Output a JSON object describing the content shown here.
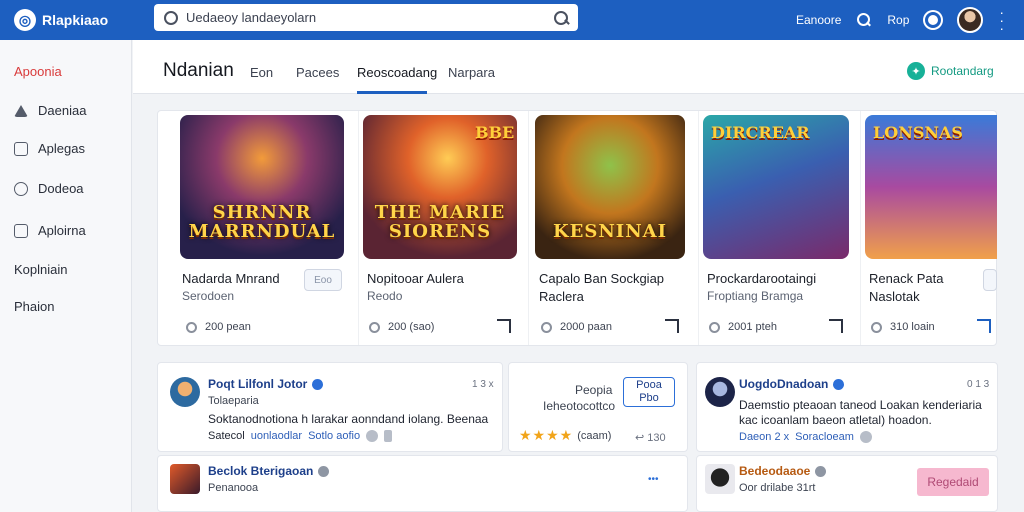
{
  "app": {
    "name": "Rlapkiaao"
  },
  "search": {
    "value": "Uedaeoy landaeyolarn"
  },
  "topbar": {
    "link1": "Eanoore",
    "link2": "Rop"
  },
  "sidebar": {
    "items": [
      {
        "label": "Apoonia"
      },
      {
        "label": "Daeniaa"
      },
      {
        "label": "Aplegas"
      },
      {
        "label": "Dodeoa"
      },
      {
        "label": "Aploirna"
      },
      {
        "label": "Koplniain"
      },
      {
        "label": "Phaion"
      }
    ]
  },
  "header": {
    "title": "Ndanian",
    "tabs": [
      {
        "label": "Eon"
      },
      {
        "label": "Pacees"
      },
      {
        "label": "Reoscoadang"
      },
      {
        "label": "Narpara"
      }
    ],
    "action": "Rootandarg"
  },
  "games": [
    {
      "art_title": "SHRNNR MARRNDUAL",
      "name": "Nadarda Mnrand",
      "sub": "Serodoen",
      "meta": "200 pean",
      "install": "Eoo"
    },
    {
      "art_title": "THE MARIE SIORENS",
      "badge": "BBE",
      "name": "Nopitooar Aulera",
      "sub": "Reodo",
      "meta": "200 (sao)"
    },
    {
      "art_title": "KESNINAI",
      "name": "Capalo Ban Sockgiap",
      "sub": "Raclera",
      "meta": "2000 paan"
    },
    {
      "art_title": "",
      "badge": "DIRCREAR",
      "name": "Prockardarootaingi",
      "sub": "Froptiang Bramga",
      "meta": "2001 pteh"
    },
    {
      "art_title": "",
      "badge": "LONSNAS",
      "name": "Renack Pata",
      "sub": "Naslotak",
      "meta": "310 loain"
    }
  ],
  "posts": {
    "p1": {
      "name": "Poqt Lilfonl Jotor",
      "time": "1 3 x",
      "sub": "Tolaeparia",
      "body": "Soktanodnotiona h larakar aonndand iolang. Beenaa",
      "foot_a": "Satecol",
      "foot_b": "uonlaodlar",
      "foot_c": "Sotlo aofio"
    },
    "p2": {
      "label1": "Peopia",
      "label2": "Ieheotocottco",
      "btn1": "Pooa",
      "btn2": "Pbo",
      "stars": "★★★★",
      "stars_label": "(caam)",
      "count": "130"
    },
    "p3": {
      "name": "UogdoDnadoan",
      "time": "0 1 3",
      "body1": "Daemstio pteaoan taneod Loakan kenderiaria",
      "body2": "kac icoanlam baeon atletal) hoadon.",
      "foot_a": "Daeon 2 x",
      "foot_b": "Soracloeam"
    },
    "p4": {
      "name": "Beclok Bterigaoan",
      "sub": "Penanooa",
      "more": "•••"
    },
    "p5": {
      "name": "Bedeodaaoe",
      "sub": "Oor drilabe",
      "sub2": "31rt",
      "btn": "Regedaid"
    }
  },
  "colors": {
    "brand": "#1d5fc0",
    "accent": "#17b198",
    "active": "#d93b3b"
  }
}
